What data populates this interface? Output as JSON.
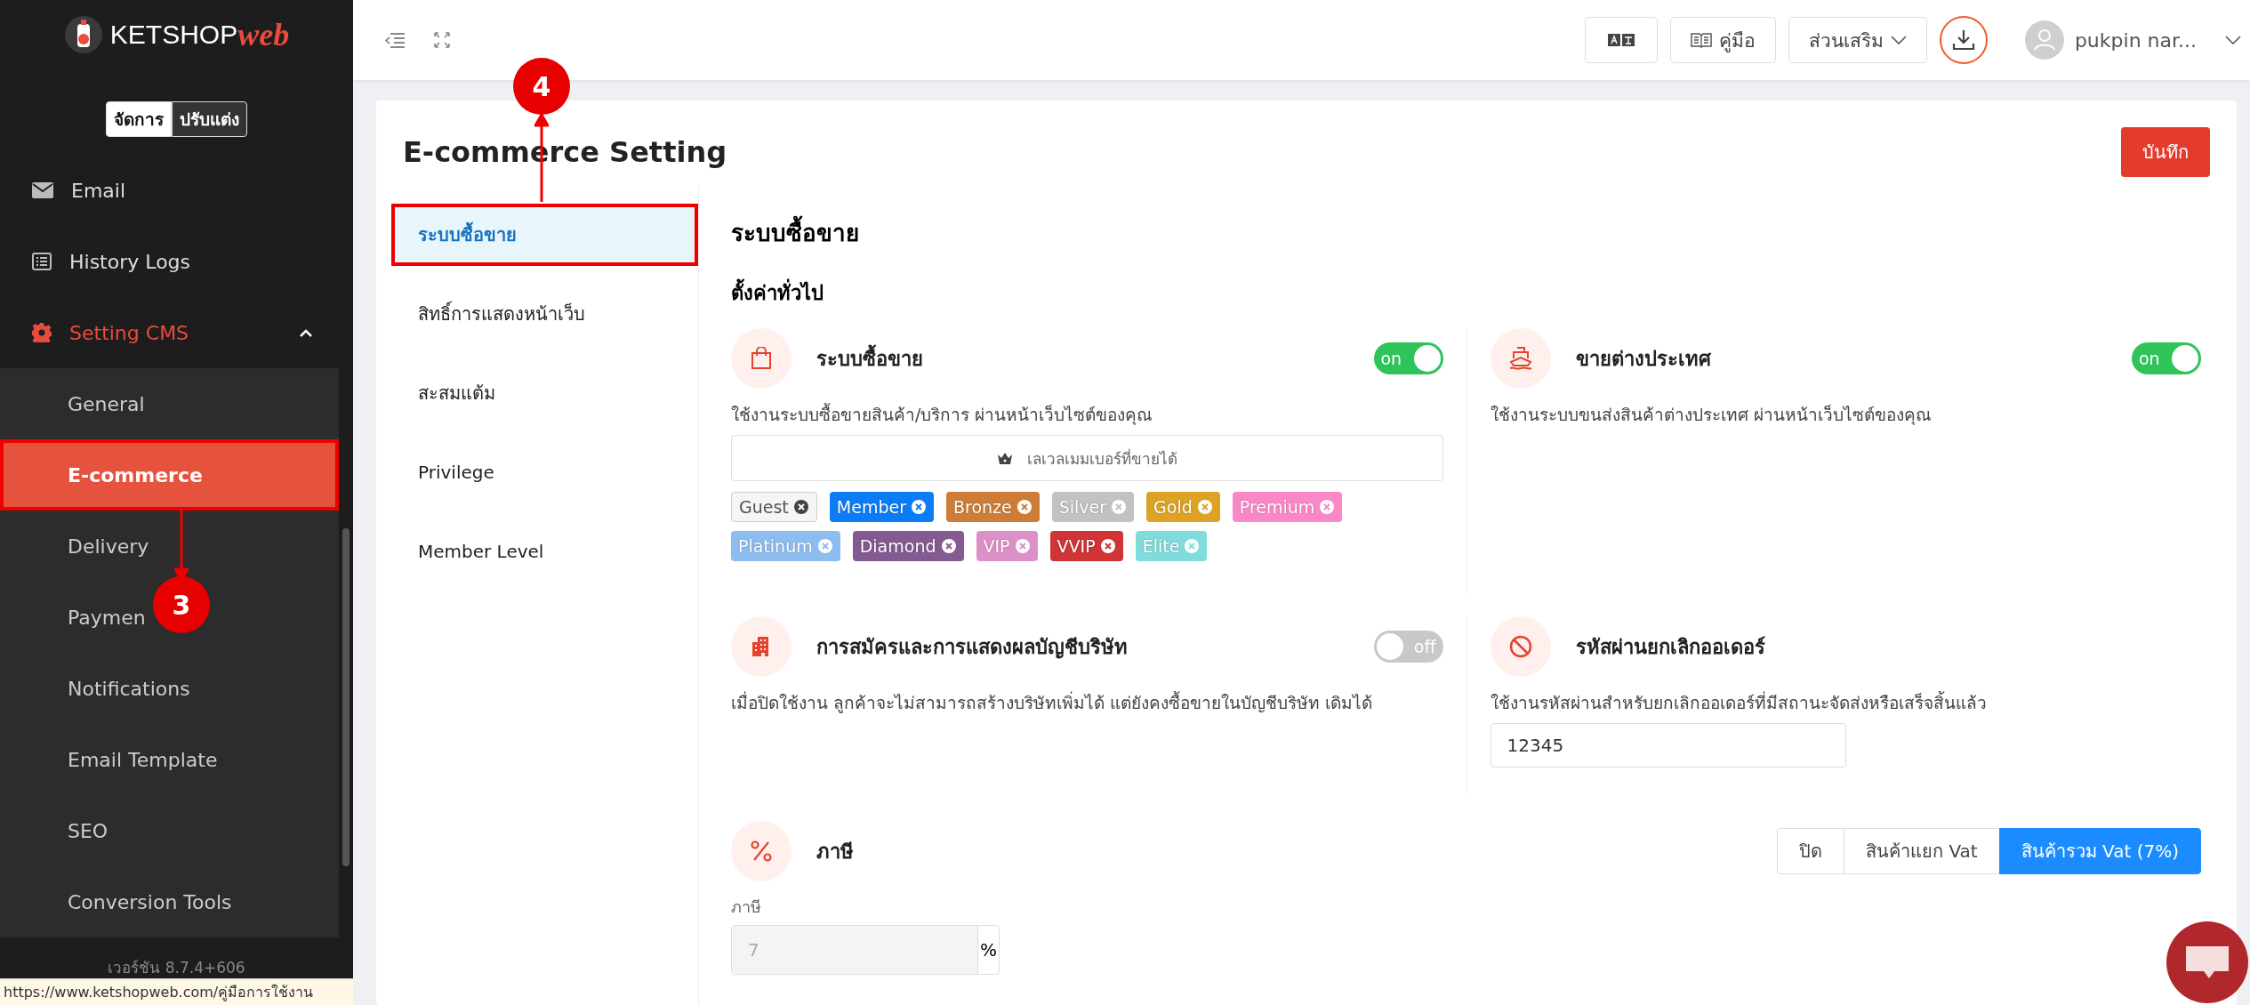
{
  "sidebar": {
    "logo": {
      "name": "KETSHOP",
      "suffix": "web"
    },
    "mode_switch": [
      {
        "label": "จัดการ",
        "selected": true
      },
      {
        "label": "ปรับแต่ง",
        "selected": false
      }
    ],
    "items": [
      {
        "label": "Email",
        "selected": false
      },
      {
        "label": "History Logs",
        "selected": false
      },
      {
        "label": "Setting CMS",
        "selected": true,
        "expanded": true,
        "children": [
          {
            "label": "General",
            "selected": false,
            "annotated": false
          },
          {
            "label": "E-commerce",
            "selected": true,
            "annotated": true
          },
          {
            "label": "Delivery",
            "selected": false,
            "annotated": false
          },
          {
            "label": "Paymen",
            "selected": false,
            "annotated": false
          },
          {
            "label": "Notifications",
            "selected": false,
            "annotated": false
          },
          {
            "label": "Email Template",
            "selected": false,
            "annotated": false
          },
          {
            "label": "SEO",
            "selected": false,
            "annotated": false
          },
          {
            "label": "Conversion Tools",
            "selected": false,
            "annotated": false
          }
        ]
      }
    ],
    "version": "เวอร์ชัน 8.7.4+606"
  },
  "status_url": "https://www.ketshopweb.com/คู่มือการใช้งาน",
  "topbar": {
    "manual_button": "คู่มือ",
    "addons_menu": "ส่วนเสริม",
    "user_name": "pukpin nar..."
  },
  "page": {
    "title": "E-commerce Setting",
    "save_button": "บันทึก",
    "tabs": [
      {
        "label": "ระบบซื้อขาย",
        "selected": true,
        "annotated": true
      },
      {
        "label": "สิทธิ์การแสดงหน้าเว็บ",
        "selected": false,
        "annotated": false
      },
      {
        "label": "สะสมแต้ม",
        "selected": false,
        "annotated": false
      },
      {
        "label": "Privilege",
        "selected": false,
        "annotated": false
      },
      {
        "label": "Member Level",
        "selected": false,
        "annotated": false
      }
    ],
    "section_title": "ระบบซื้อขาย",
    "subsection_title": "ตั้งค่าทั่วไป",
    "features": [
      {
        "kind": "toggle",
        "title": "ระบบซื้อขาย",
        "description": "ใช้งานระบบซื้อขายสินค้า/บริการ ผ่านหน้าเว็บไซต์ของคุณ",
        "on": true,
        "switch_label": "on",
        "member_select": {
          "placeholder": "เลเวลเมมเบอร์ที่ขายได้",
          "tags": [
            {
              "label": "Guest",
              "color": "#f5f5f5"
            },
            {
              "label": "Member",
              "color": "#0b7cf5"
            },
            {
              "label": "Bronze",
              "color": "#cd7d37"
            },
            {
              "label": "Silver",
              "color": "#c2c2c2"
            },
            {
              "label": "Gold",
              "color": "#dca324"
            },
            {
              "label": "Premium",
              "color": "#fb88c6"
            },
            {
              "label": "Platinum",
              "color": "#8dbdf0"
            },
            {
              "label": "Diamond",
              "color": "#845a92"
            },
            {
              "label": "VIP",
              "color": "#dd90c8"
            },
            {
              "label": "VVIP",
              "color": "#d03434"
            },
            {
              "label": "Elite",
              "color": "#7fdcdc"
            }
          ]
        }
      },
      {
        "kind": "toggle",
        "title": "ขายต่างประเทศ",
        "description": "ใช้งานระบบขนส่งสินค้าต่างประเทศ ผ่านหน้าเว็บไซต์ของคุณ",
        "on": true,
        "switch_label": "on"
      },
      {
        "kind": "toggle",
        "title": "การสมัครและการแสดงผลบัญชีบริษัท",
        "description": "เมื่อปิดใช้งาน ลูกค้าจะไม่สามารถสร้างบริษัทเพิ่มได้ แต่ยังคงซื้อขายในบัญชีบริษัท เดิมได้",
        "on": false,
        "switch_label": "off"
      },
      {
        "kind": "input",
        "title": "รหัสผ่านยกเลิกออเดอร์",
        "description": "ใช้งานรหัสผ่านสำหรับยกเลิกออเดอร์ที่มีสถานะจัดส่งหรือเสร็จสิ้นแล้ว",
        "value": "12345"
      }
    ],
    "tax": {
      "title": "ภาษี",
      "options": [
        {
          "label": "ปิด",
          "selected": false
        },
        {
          "label": "สินค้าแยก Vat",
          "selected": false
        },
        {
          "label": "สินค้ารวม Vat (7%)",
          "selected": true
        }
      ],
      "field_label": "ภาษี",
      "value": "7",
      "unit": "%",
      "disabled": true
    }
  },
  "annotations": [
    {
      "number": "4"
    },
    {
      "number": "3"
    }
  ]
}
